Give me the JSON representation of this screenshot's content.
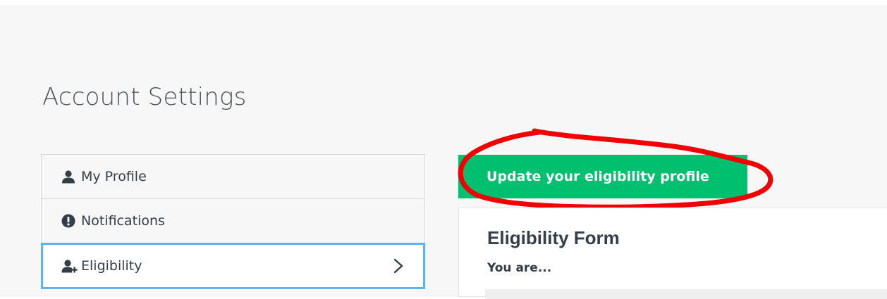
{
  "page": {
    "title": "Account Settings"
  },
  "sidebar": {
    "items": [
      {
        "label": "My Profile",
        "icon": "user-icon"
      },
      {
        "label": "Notifications",
        "icon": "alert-circle-icon"
      },
      {
        "label": "Eligibility",
        "icon": "user-plus-icon",
        "active": true
      }
    ]
  },
  "main": {
    "update_button_label": "Update your eligibility profile",
    "form": {
      "title": "Eligibility Form",
      "subtitle": "You are..."
    }
  },
  "colors": {
    "accent_green": "#00bf6f",
    "active_border_blue": "#63b0ec",
    "annotation_red": "#f00000",
    "page_background": "#f6f7f6"
  }
}
